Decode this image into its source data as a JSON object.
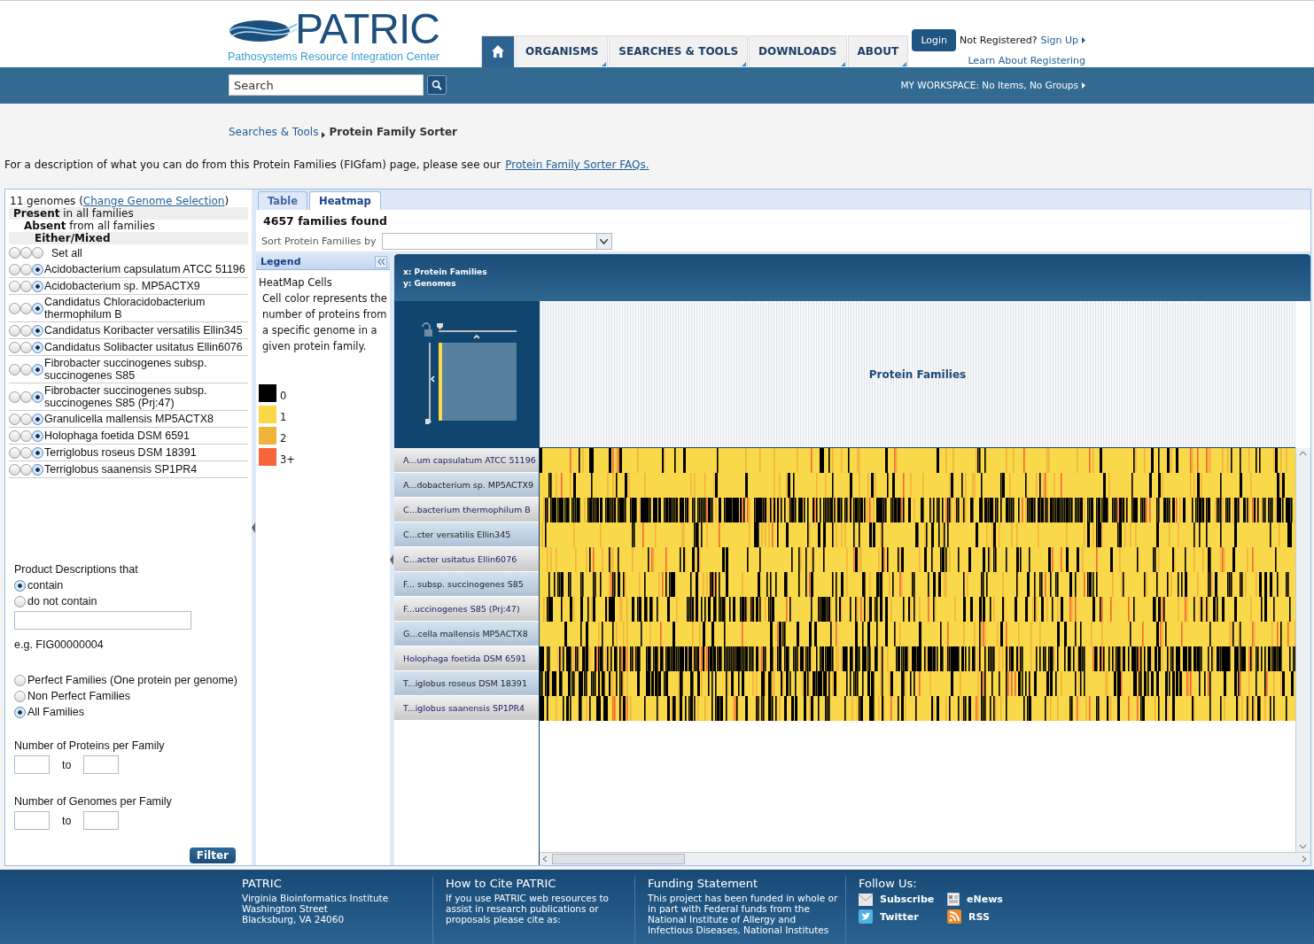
{
  "header": {
    "logo": {
      "title": "PATRIC",
      "subtitle": "Pathosystems Resource Integration Center"
    },
    "nav": [
      {
        "kind": "home",
        "selected": true
      },
      {
        "kind": "text",
        "label": "ORGANISMS",
        "selected": false
      },
      {
        "kind": "text",
        "label": "SEARCHES & TOOLS",
        "selected": false
      },
      {
        "kind": "text",
        "label": "DOWNLOADS",
        "selected": false
      },
      {
        "kind": "text",
        "label": "ABOUT",
        "selected": false
      }
    ],
    "login": {
      "button": "Login",
      "prompt": "Not Registered?",
      "signup": "Sign Up",
      "learn": "Learn About Registering"
    }
  },
  "toolbar": {
    "search": {
      "placeholder": "Search"
    },
    "workspace": "MY WORKSPACE: No Items, No Groups"
  },
  "breadcrumb": {
    "parent": "Searches & Tools",
    "current": "Protein Family Sorter"
  },
  "intro": {
    "text": "For a description of what you can do from this Protein Families (FIGfam) page, please see our",
    "link": "Protein Family Sorter FAQs."
  },
  "filter_panel": {
    "summary": {
      "prefix": "11 genomes (",
      "link": "Change Genome Selection",
      "suffix": ")"
    },
    "key": [
      {
        "text": "**Present** in all families",
        "bold": false
      },
      {
        "text": "**Absent** from all families",
        "bold": false
      },
      {
        "text": "Either/Mixed",
        "bold": true
      }
    ],
    "set_all": {
      "label": "Set all",
      "radios": [
        {
          "selected": false
        },
        {
          "selected": false
        },
        {
          "selected": false
        }
      ]
    },
    "genomes": [
      {
        "name": "Acidobacterium capsulatum ATCC 51196",
        "radios": [
          {
            "selected": false
          },
          {
            "selected": false
          },
          {
            "selected": true
          }
        ]
      },
      {
        "name": "Acidobacterium sp. MP5ACTX9",
        "radios": [
          {
            "selected": false
          },
          {
            "selected": false
          },
          {
            "selected": true
          }
        ]
      },
      {
        "name": "Candidatus Chloracidobacterium thermophilum B",
        "radios": [
          {
            "selected": false
          },
          {
            "selected": false
          },
          {
            "selected": true
          }
        ]
      },
      {
        "name": "Candidatus Koribacter versatilis Ellin345",
        "radios": [
          {
            "selected": false
          },
          {
            "selected": false
          },
          {
            "selected": true
          }
        ]
      },
      {
        "name": "Candidatus Solibacter usitatus Ellin6076",
        "radios": [
          {
            "selected": false
          },
          {
            "selected": false
          },
          {
            "selected": true
          }
        ]
      },
      {
        "name": "Fibrobacter succinogenes subsp. succinogenes S85",
        "radios": [
          {
            "selected": false
          },
          {
            "selected": false
          },
          {
            "selected": true
          }
        ]
      },
      {
        "name": "Fibrobacter succinogenes subsp. succinogenes S85 (Prj:47)",
        "radios": [
          {
            "selected": false
          },
          {
            "selected": false
          },
          {
            "selected": true
          }
        ]
      },
      {
        "name": "Granulicella mallensis MP5ACTX8",
        "radios": [
          {
            "selected": false
          },
          {
            "selected": false
          },
          {
            "selected": true
          }
        ]
      },
      {
        "name": "Holophaga foetida DSM 6591",
        "radios": [
          {
            "selected": false
          },
          {
            "selected": false
          },
          {
            "selected": true
          }
        ]
      },
      {
        "name": "Terriglobus roseus DSM 18391",
        "radios": [
          {
            "selected": false
          },
          {
            "selected": false
          },
          {
            "selected": true
          }
        ]
      },
      {
        "name": "Terriglobus saanensis SP1PR4",
        "radios": [
          {
            "selected": false
          },
          {
            "selected": false
          },
          {
            "selected": true
          }
        ]
      }
    ],
    "description": {
      "label": "Product Descriptions that",
      "options": [
        {
          "label": "contain",
          "selected": true
        },
        {
          "label": "do not contain",
          "selected": false
        }
      ],
      "example": "e.g. FIG00000004"
    },
    "family_types": [
      {
        "label": "Perfect Families (One protein per genome)",
        "selected": false
      },
      {
        "label": "Non Perfect Families",
        "selected": false
      },
      {
        "label": "All Families",
        "selected": true
      }
    ],
    "ranges": [
      {
        "label": "Number of Proteins per Family",
        "joiner": "to"
      },
      {
        "label": "Number of Genomes per Family",
        "joiner": "to"
      }
    ],
    "filter_button": "Filter"
  },
  "results": {
    "tabs": [
      {
        "label": "Table",
        "selected": false
      },
      {
        "label": "Heatmap",
        "selected": true
      }
    ],
    "count": "4657 families found",
    "sort": {
      "label": "Sort Protein Families by"
    }
  },
  "legend": {
    "title": "Legend",
    "heading": "HeatMap Cells",
    "description": "Cell color represents the number of proteins from a specific genome in a given protein family.",
    "scale": [
      {
        "label": "0",
        "color": "#000000"
      },
      {
        "label": "1",
        "color": "#f9d94a"
      },
      {
        "label": "2",
        "color": "#f2b33d"
      },
      {
        "label": "3+",
        "color": "#f7653a"
      }
    ]
  },
  "heatmap": {
    "x_axis": "x: Protein Families",
    "y_axis": "y: Genomes",
    "column_header": "Protein Families",
    "rows": [
      "A...um capsulatum ATCC 51196",
      "A...dobacterium sp. MP5ACTX9",
      "C...bacterium thermophilum B",
      "C...cter versatilis Ellin345",
      "C...acter usitatus Ellin6076",
      "F... subsp. succinogenes S85",
      "F...uccinogenes S85 (Prj:47)",
      "G...cella mallensis MP5ACTX8",
      "Holophaga foetida DSM 6591",
      "T...iglobus roseus DSM 18391",
      "T...iglobus saanensis SP1PR4"
    ]
  },
  "footer": {
    "columns": [
      {
        "title": "PATRIC",
        "lines": [
          "Virginia Bioinformatics Institute",
          "Washington Street",
          "Blacksburg, VA 24060"
        ]
      },
      {
        "title": "How to Cite PATRIC",
        "lines": [
          "If you use PATRIC web resources to",
          "assist in research publications or",
          "proposals please cite as:"
        ]
      },
      {
        "title": "Funding Statement",
        "lines": [
          "This project has been funded in whole or",
          "in part with Federal funds from the",
          "National Institute of Allergy and",
          "Infectious Diseases, National Institutes"
        ]
      }
    ],
    "follow": {
      "title": "Follow Us:",
      "links": [
        {
          "kind": "mail",
          "label": "Subscribe"
        },
        {
          "kind": "news",
          "label": "eNews"
        },
        {
          "kind": "twitter",
          "label": "Twitter"
        },
        {
          "kind": "rss",
          "label": "RSS"
        }
      ]
    }
  }
}
